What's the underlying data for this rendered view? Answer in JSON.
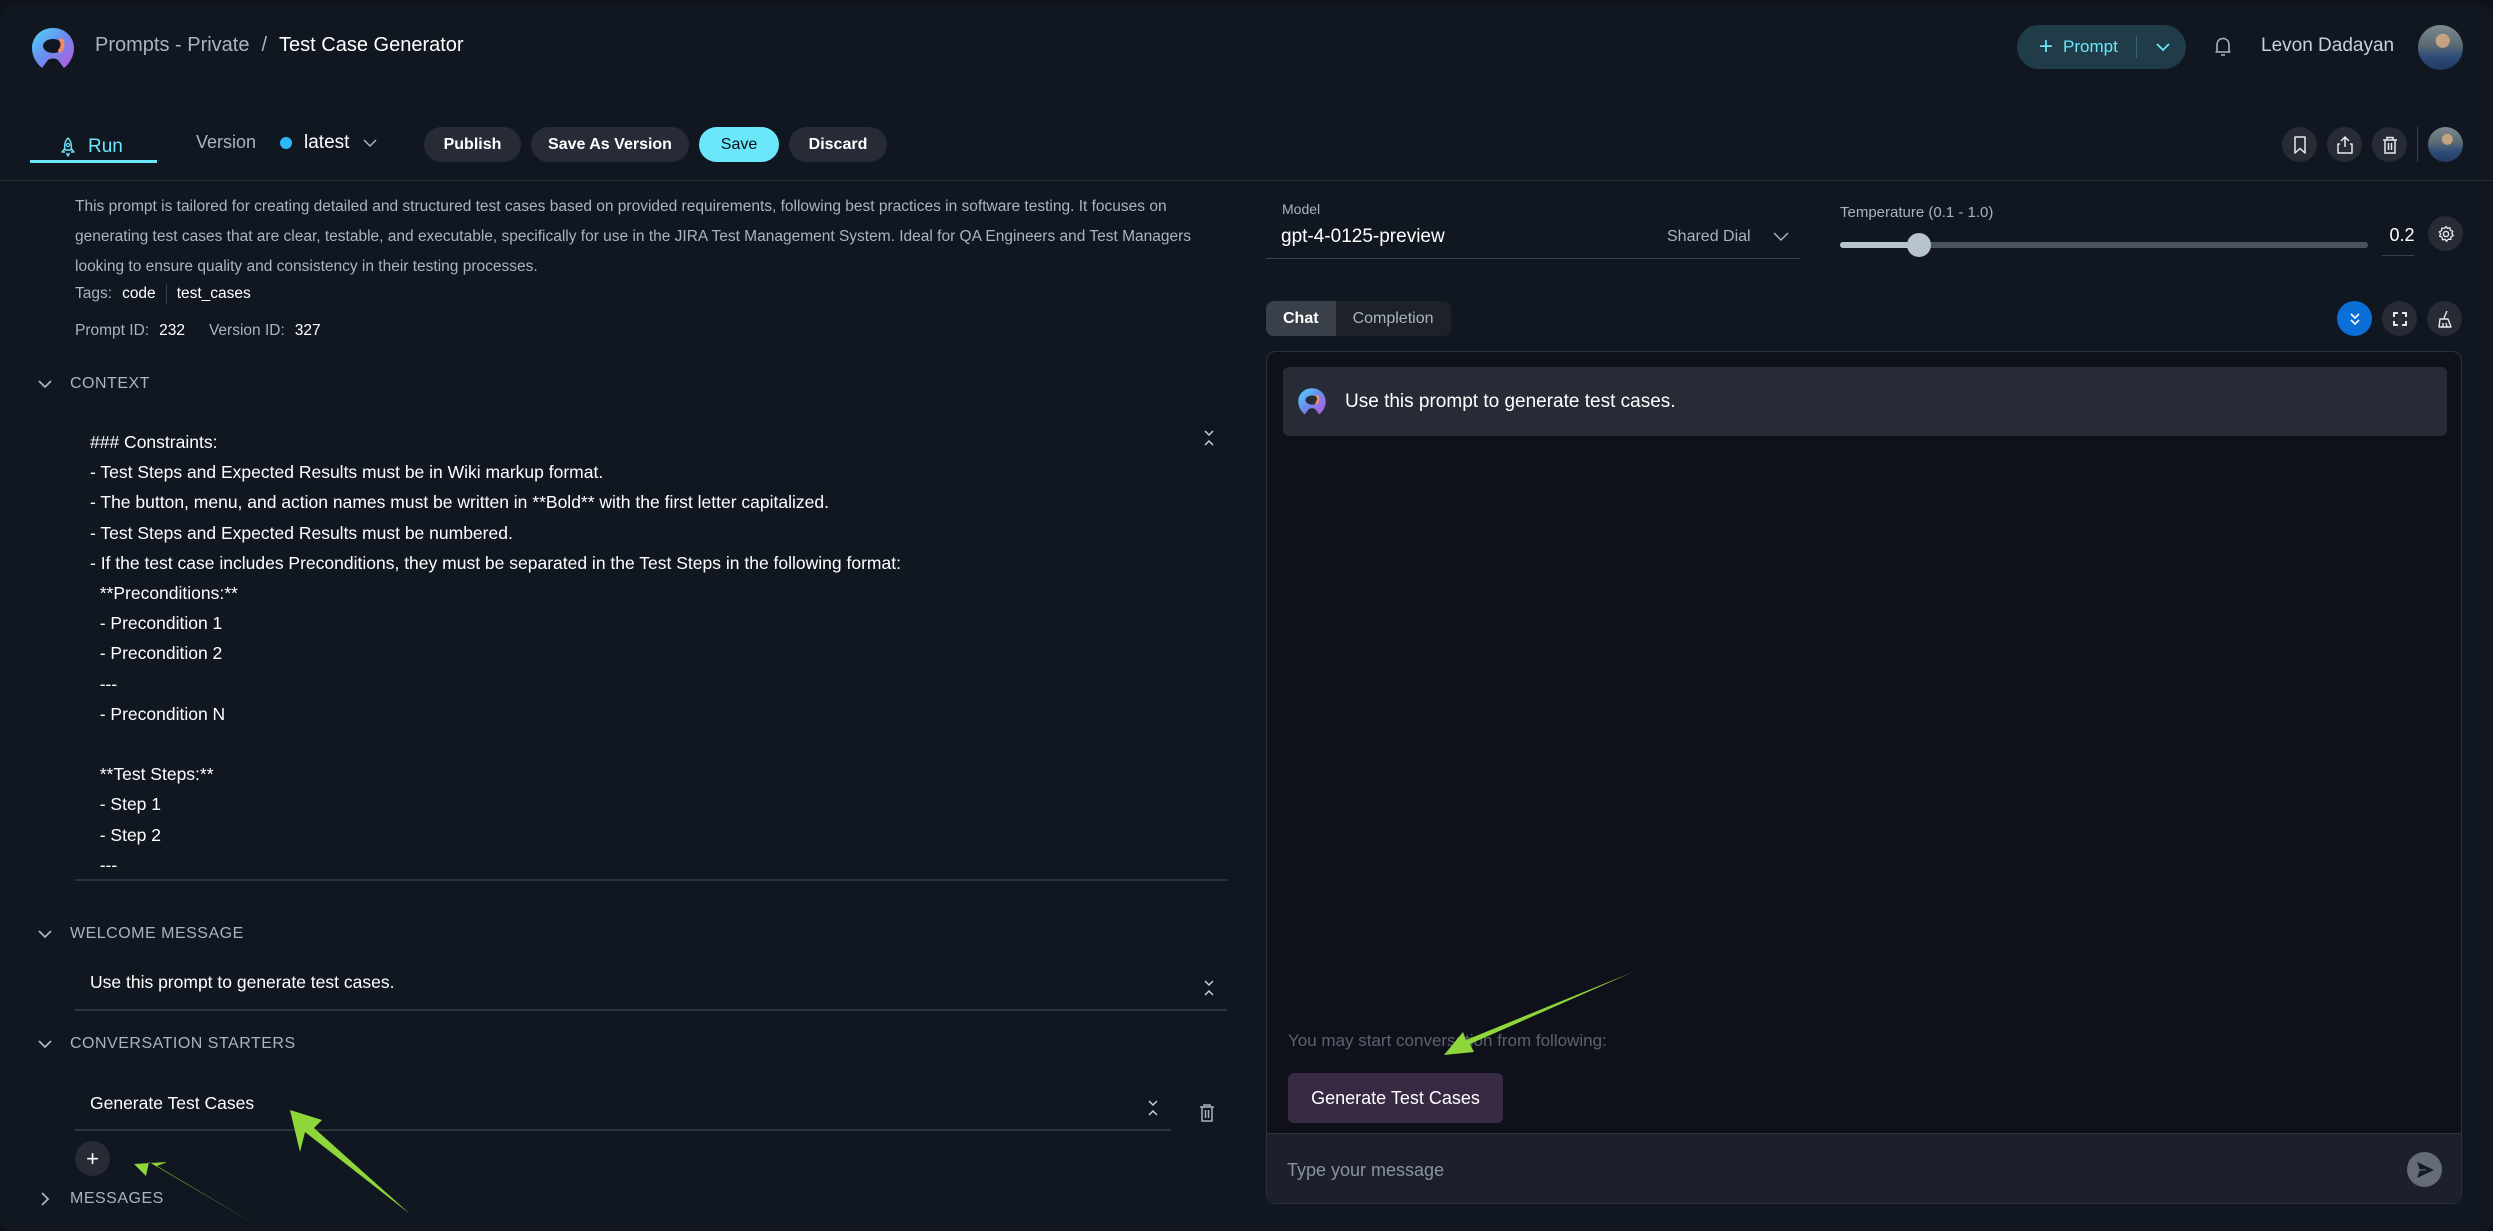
{
  "header": {
    "breadcrumb": {
      "parent": "Prompts - Private",
      "separator": "/",
      "current": "Test Case Generator"
    },
    "new_prompt_button": "Prompt",
    "user_name": "Levon Dadayan"
  },
  "toolbar": {
    "run_tab": "Run",
    "version_label": "Version",
    "version_value": "latest",
    "publish": "Publish",
    "save_as_version": "Save As Version",
    "save": "Save",
    "discard": "Discard"
  },
  "prompt_info": {
    "description": "This prompt is tailored for creating detailed and structured test cases based on provided requirements, following best practices in software testing. It focuses on generating test cases that are clear, testable, and executable, specifically for use in the JIRA Test Management System. Ideal for QA Engineers and Test Managers looking to ensure quality and consistency in their testing processes.",
    "tags_label": "Tags:",
    "tags": [
      "code",
      "test_cases"
    ],
    "prompt_id_label": "Prompt ID:",
    "prompt_id": "232",
    "version_id_label": "Version ID:",
    "version_id": "327"
  },
  "sections": {
    "context": {
      "title": "CONTEXT",
      "text": "### Constraints:\n- Test Steps and Expected Results must be in Wiki markup format.\n- The button, menu, and action names must be written in **Bold** with the first letter capitalized.\n- Test Steps and Expected Results must be numbered.\n- If the test case includes Preconditions, they must be separated in the Test Steps in the following format:\n  **Preconditions:**\n  - Precondition 1\n  - Precondition 2\n  ---\n  - Precondition N\n\n  **Test Steps:**\n  - Step 1\n  - Step 2\n  ---"
    },
    "welcome_message": {
      "title": "WELCOME MESSAGE",
      "text": "Use this prompt to generate test cases."
    },
    "conversation_starters": {
      "title": "CONVERSATION STARTERS",
      "items": [
        "Generate Test Cases"
      ]
    },
    "messages": {
      "title": "MESSAGES"
    }
  },
  "model": {
    "label": "Model",
    "value": "gpt-4-0125-preview",
    "source": "Shared Dial"
  },
  "temperature": {
    "label": "Temperature (0.1 - 1.0)",
    "min": 0.1,
    "max": 1.0,
    "value": "0.2"
  },
  "chat": {
    "modes": [
      "Chat",
      "Completion"
    ],
    "active_mode": "Chat",
    "welcome_bubble": "Use this prompt to generate test cases.",
    "starter_hint": "You may start conversation from following:",
    "starters": [
      "Generate Test Cases"
    ],
    "input_placeholder": "Type your message"
  },
  "colors": {
    "accent": "#6ae8fa",
    "background": "#111721",
    "scroll_button": "#0b6fd8",
    "starter_chip": "#382a43",
    "annotation_arrow": "#8fd63a"
  }
}
